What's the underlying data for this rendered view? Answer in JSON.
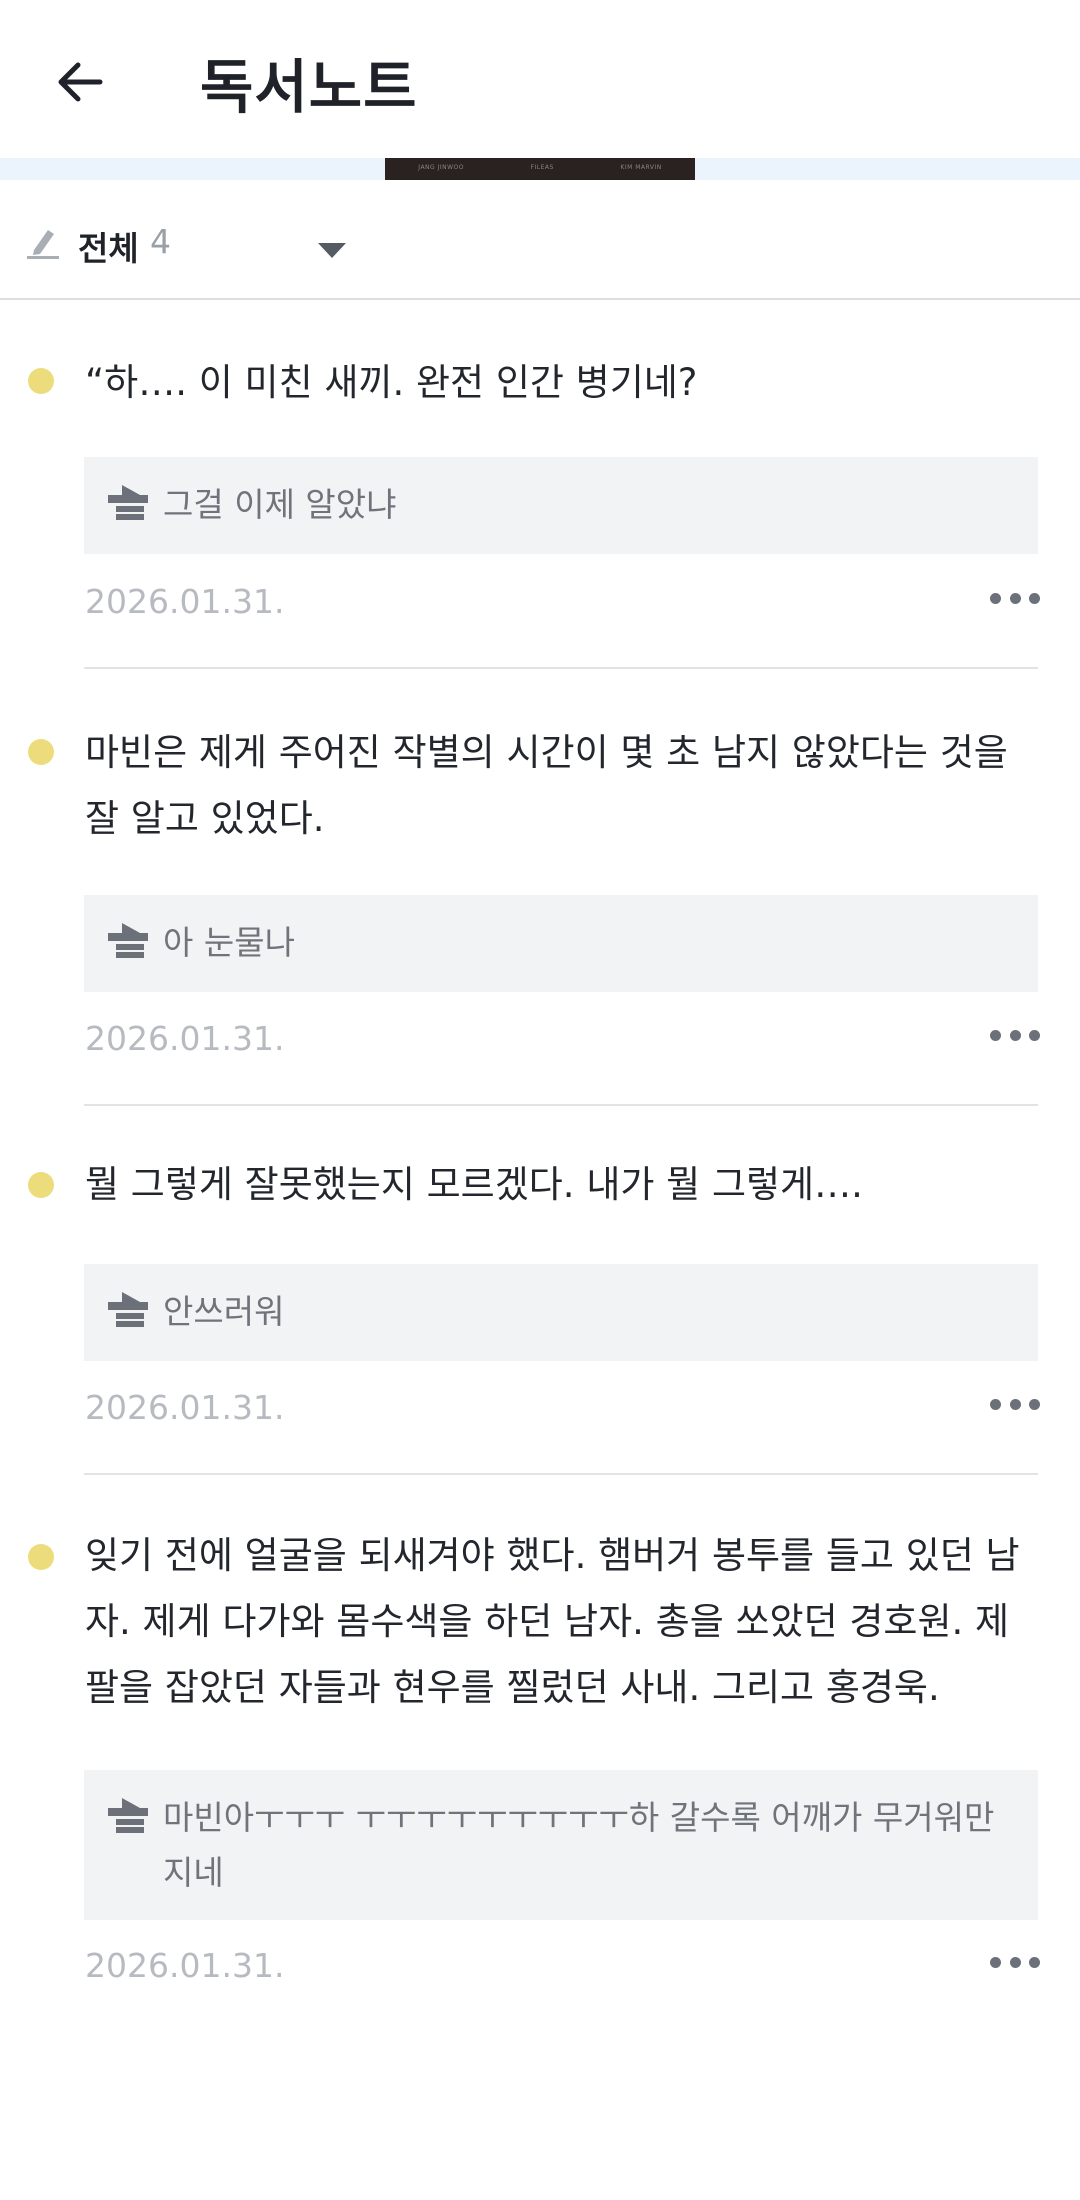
{
  "header": {
    "title": "독서노트",
    "back_icon": "back-arrow-icon"
  },
  "cover": {
    "credits": [
      "JANG JINWOO",
      "FILEAS",
      "KIM MARVIN"
    ]
  },
  "filter": {
    "label": "전체",
    "count": "4"
  },
  "notes": [
    {
      "quote": "“하…. 이 미친 새끼. 완전 인간 병기네?",
      "memo": "그걸 이제 알았냐",
      "date": "2026.01.31."
    },
    {
      "quote": "마빈은 제게 주어진 작별의 시간이 몇 초 남지 않았다는 것을 잘 알고 있었다.",
      "memo": "아 눈물나",
      "date": "2026.01.31."
    },
    {
      "quote": "뭘 그렇게 잘못했는지 모르겠다. 내가 뭘 그렇게….",
      "memo": "안쓰러워",
      "date": "2026.01.31."
    },
    {
      "quote": "잊기 전에 얼굴을 되새겨야 했다. 햄버거 봉투를 들고 있던 남자. 제게 다가와 몸수색을 하던 남자. 총을 쏘았던 경호원. 제 팔을 잡았던 자들과 현우를 찔렀던 사내. 그리고 홍경욱.",
      "memo": "마빈아ㅜㅜㅜ ㅜㅜㅜㅜㅜㅜㅜㅜㅜ하 갈수록 어깨가 무거워만지네",
      "date": "2026.01.31."
    }
  ],
  "colors": {
    "dot": "#ecdc7c",
    "memo_bg": "#f2f3f5",
    "strip": "#ebf4fc"
  }
}
